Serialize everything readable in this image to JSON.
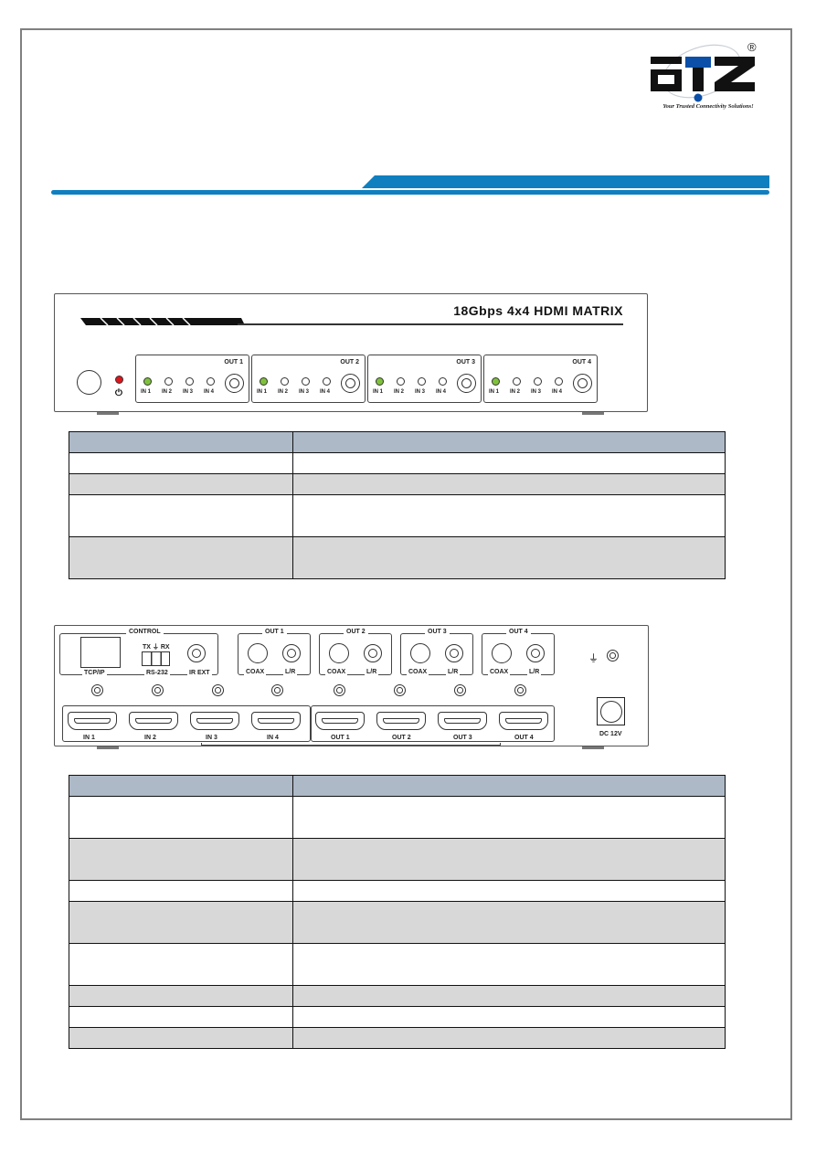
{
  "brand": {
    "logo_text": "aTZ",
    "tagline": "Your Trusted Connectivity Solutions!",
    "registered_mark": "®",
    "colors": {
      "accent": "#0f7fc0",
      "logo_black": "#111111",
      "logo_blue": "#0b4fa8"
    }
  },
  "front_panel": {
    "model_title": "18Gbps 4x4 HDMI MATRIX",
    "power_icon": "power-icon",
    "power_led_color": "#e0141c",
    "active_led_color": "#7fc23a",
    "outputs": [
      {
        "label": "OUT 1",
        "inputs": [
          "IN 1",
          "IN 2",
          "IN 3",
          "IN 4"
        ],
        "active_input": "IN 1"
      },
      {
        "label": "OUT 2",
        "inputs": [
          "IN 1",
          "IN 2",
          "IN 3",
          "IN 4"
        ],
        "active_input": "IN 1"
      },
      {
        "label": "OUT 3",
        "inputs": [
          "IN 1",
          "IN 2",
          "IN 3",
          "IN 4"
        ],
        "active_input": "IN 1"
      },
      {
        "label": "OUT 4",
        "inputs": [
          "IN 1",
          "IN 2",
          "IN 3",
          "IN 4"
        ],
        "active_input": "IN 1"
      }
    ]
  },
  "front_table": {
    "rows": [
      {
        "style": "header",
        "cells": [
          "",
          ""
        ]
      },
      {
        "style": "white",
        "cells": [
          "",
          ""
        ]
      },
      {
        "style": "gray",
        "cells": [
          "",
          ""
        ]
      },
      {
        "style": "white",
        "cells": [
          "",
          ""
        ]
      },
      {
        "style": "gray",
        "cells": [
          "",
          ""
        ]
      }
    ]
  },
  "rear_panel": {
    "control_label": "CONTROL",
    "tcpip_label": "TCP/IP",
    "rs232_label": "RS-232",
    "rs232_pins": "TX ⏚ RX",
    "irext_label": "IR EXT",
    "audio_outputs": [
      {
        "label": "OUT 1",
        "coax": "COAX",
        "lr": "L/R"
      },
      {
        "label": "OUT 2",
        "coax": "COAX",
        "lr": "L/R"
      },
      {
        "label": "OUT 3",
        "coax": "COAX",
        "lr": "L/R"
      },
      {
        "label": "OUT 4",
        "coax": "COAX",
        "lr": "L/R"
      }
    ],
    "hdmi_inputs": [
      "IN 1",
      "IN 2",
      "IN 3",
      "IN 4"
    ],
    "hdmi_outputs": [
      "OUT 1",
      "OUT 2",
      "OUT 3",
      "OUT 4"
    ],
    "ground_symbol": "⏚",
    "dc_label": "DC 12V"
  },
  "rear_table": {
    "rows": [
      {
        "style": "header",
        "cells": [
          "",
          ""
        ]
      },
      {
        "style": "white",
        "cells": [
          "",
          ""
        ]
      },
      {
        "style": "gray",
        "cells": [
          "",
          ""
        ]
      },
      {
        "style": "white",
        "cells": [
          "",
          ""
        ]
      },
      {
        "style": "gray",
        "cells": [
          "",
          ""
        ]
      },
      {
        "style": "white",
        "cells": [
          "",
          ""
        ]
      },
      {
        "style": "gray",
        "cells": [
          "",
          ""
        ]
      },
      {
        "style": "white",
        "cells": [
          "",
          ""
        ]
      },
      {
        "style": "gray",
        "cells": [
          "",
          ""
        ]
      }
    ]
  }
}
